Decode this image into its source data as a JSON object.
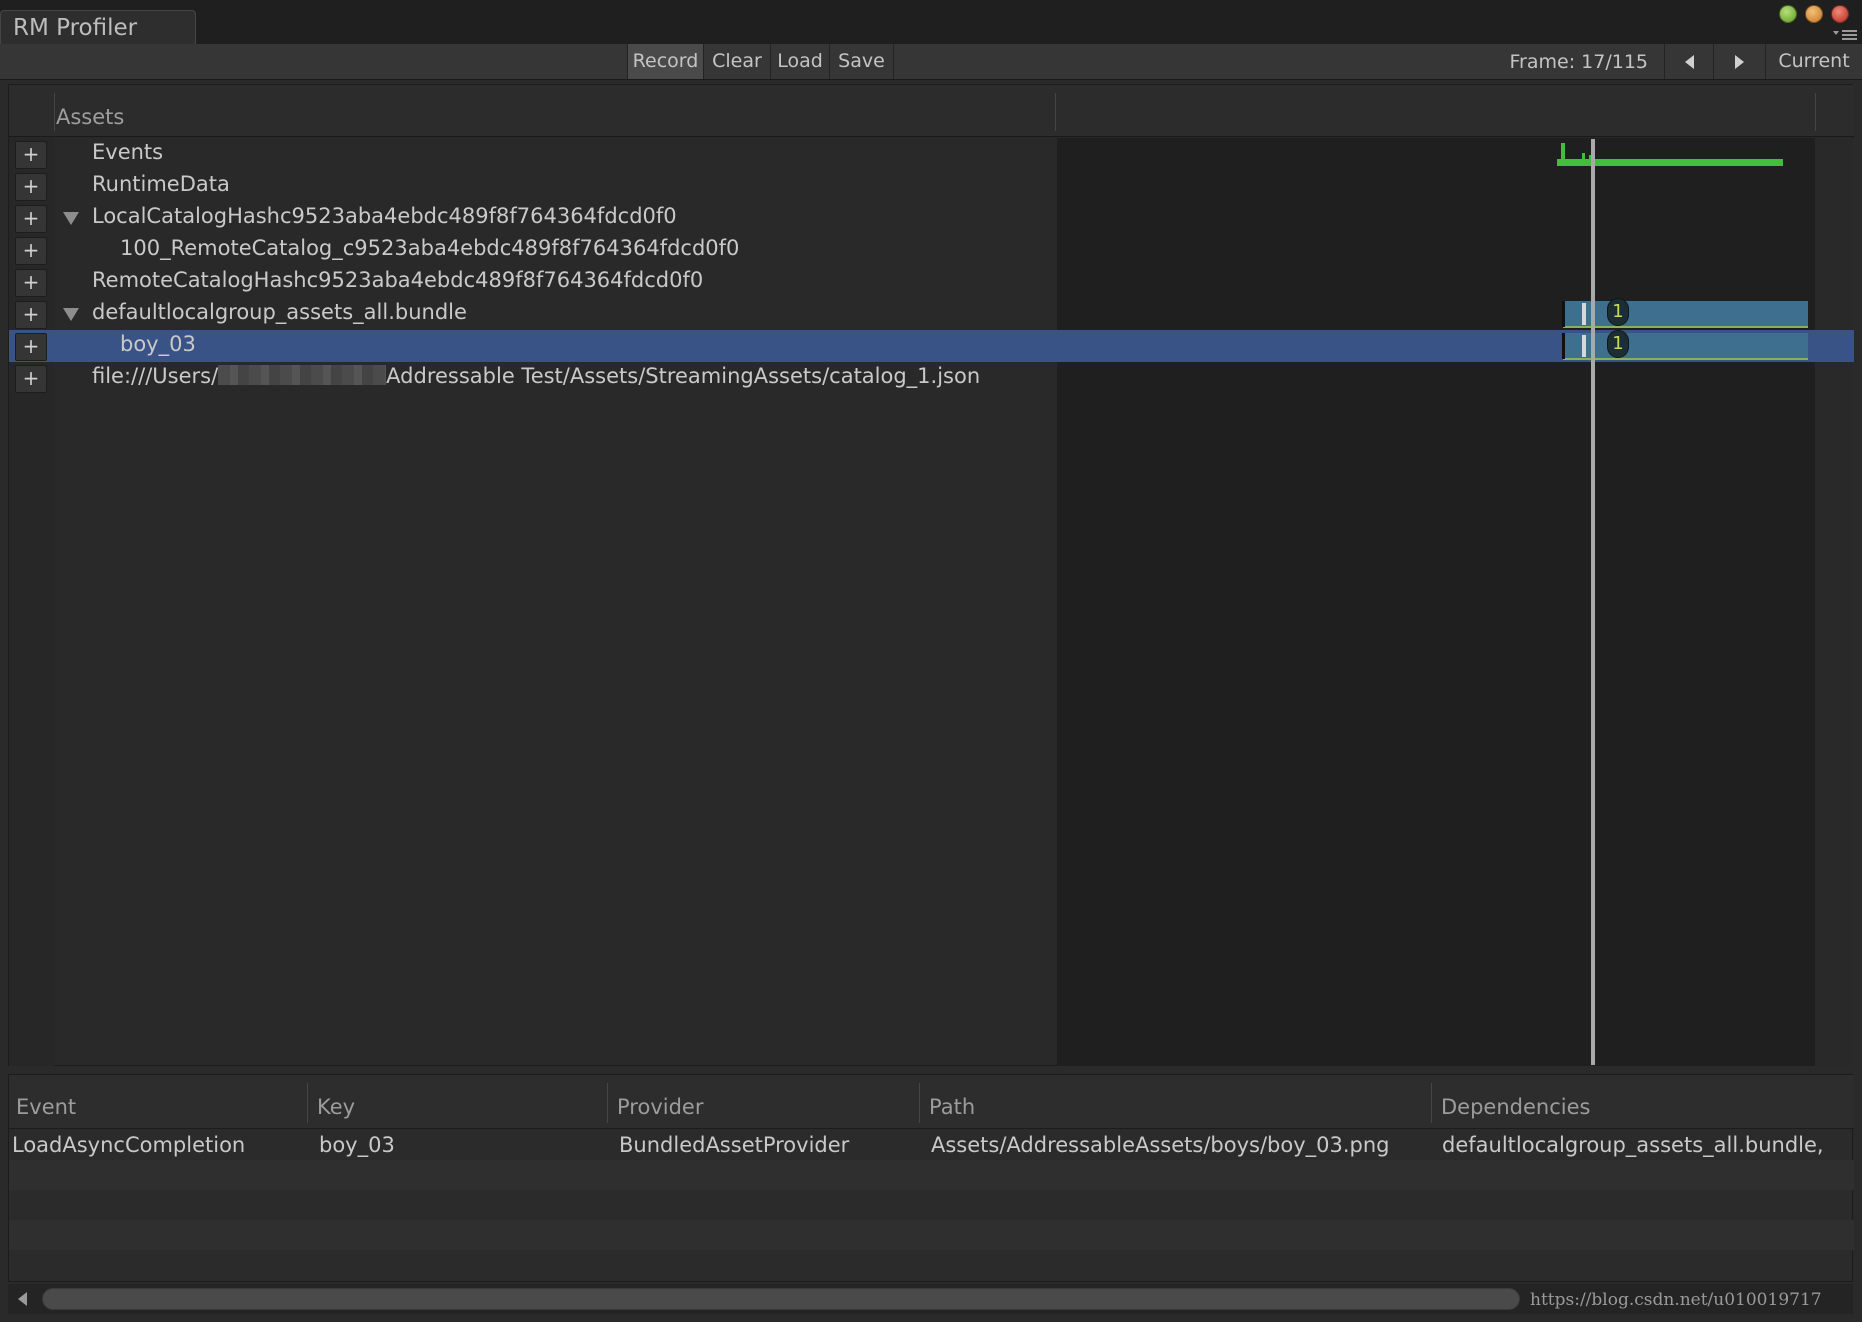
{
  "window": {
    "tab_title": "RM Profiler"
  },
  "toolbar": {
    "record": "Record",
    "clear": "Clear",
    "load": "Load",
    "save": "Save",
    "frame": "Frame: 17/115",
    "current": "Current"
  },
  "tree": {
    "header": "Assets",
    "rows": [
      {
        "label": "Events",
        "expanded": false
      },
      {
        "label": "RuntimeData",
        "expanded": false
      },
      {
        "label": "LocalCatalogHashc9523aba4ebdc489f8f764364fdcd0f0",
        "expanded": true
      },
      {
        "label": "100_RemoteCatalog_c9523aba4ebdc489f8f764364fdcd0f0",
        "expanded": false
      },
      {
        "label": "RemoteCatalogHashc9523aba4ebdc489f8f764364fdcd0f0",
        "expanded": false
      },
      {
        "label": "defaultlocalgroup_assets_all.bundle",
        "expanded": true
      },
      {
        "label": "boy_03",
        "expanded": false,
        "selected": true
      },
      {
        "label_prefix": "file:///Users/",
        "label_suffix": "Addressable Test/Assets/StreamingAssets/catalog_1.json",
        "expanded": false
      }
    ],
    "ref_count_bundle": "1",
    "ref_count_asset": "1"
  },
  "events": {
    "columns": [
      "Event",
      "Key",
      "Provider",
      "Path",
      "Dependencies"
    ],
    "rows": [
      [
        "LoadAsyncCompletion",
        "boy_03",
        "BundledAssetProvider",
        "Assets/AddressableAssets/boys/boy_03.png",
        "defaultlocalgroup_assets_all.bundle,"
      ]
    ]
  },
  "footer": {
    "watermark": "https://blog.csdn.net/u010019717"
  },
  "colors": {
    "selection": "#3a5387",
    "event_graph": "#3fbf3a",
    "bundle_bar": "#3f6f8e",
    "playhead": "#a9a9a9"
  }
}
